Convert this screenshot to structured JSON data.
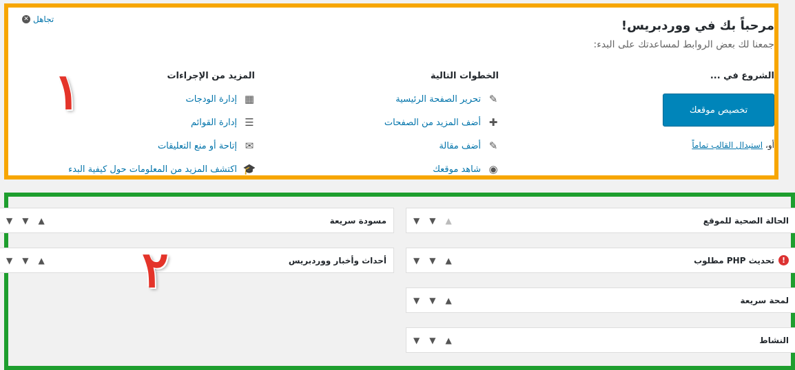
{
  "welcome": {
    "dismiss_label": "تجاهل",
    "title": "مرحباً بك في ووردبريس!",
    "subtitle": "جمعنا لك بعض الروابط لمساعدتك على البدء:",
    "get_started": {
      "heading": "الشروع في ...",
      "button_label": "تخصيص موقعك",
      "or_label": "أو،",
      "change_theme_label": "استبدال القالب تماماً"
    },
    "next_steps": {
      "heading": "الخطوات التالية",
      "items": [
        {
          "label": "تحرير الصفحة الرئيسية",
          "icon": "edit-icon"
        },
        {
          "label": "أضف المزيد من الصفحات",
          "icon": "plus-icon"
        },
        {
          "label": "أضف مقالة",
          "icon": "edit-icon"
        },
        {
          "label": "شاهد موقعك",
          "icon": "view-icon"
        }
      ]
    },
    "more_actions": {
      "heading": "المزيد من الإجراءات",
      "items": [
        {
          "label": "إدارة الودجات",
          "icon": "widgets-icon"
        },
        {
          "label": "إدارة القوائم",
          "icon": "menus-icon"
        },
        {
          "label": "إتاحة أو منع التعليقات",
          "icon": "comments-icon"
        },
        {
          "label": "اكتشف المزيد من المعلومات حول كيفية البدء",
          "icon": "learn-icon"
        }
      ]
    },
    "annotation_number": "١",
    "accent_color": "#f7a600"
  },
  "widgets": {
    "annotation_number": "٢",
    "accent_color": "#1e9e2e",
    "right_column": [
      {
        "title": "الحالة الصحية للموقع"
      },
      {
        "title": "تحديث PHP مطلوب",
        "alert": "!"
      },
      {
        "title": "لمحة سريعة"
      },
      {
        "title": "النشاط"
      }
    ],
    "left_column": [
      {
        "title": "مسودة سريعة"
      },
      {
        "title": "أحداث وأخبار ووردبريس"
      }
    ],
    "controls": {
      "up": "▲",
      "down": "▼",
      "toggle": "▼"
    }
  }
}
